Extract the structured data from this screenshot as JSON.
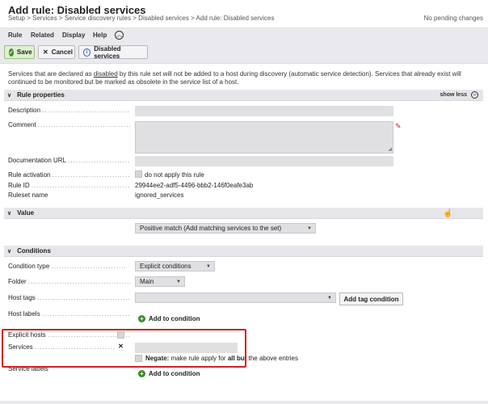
{
  "header": {
    "title": "Add rule: Disabled services",
    "breadcrumb": "Setup > Services > Service discovery rules > Disabled services > Add rule: Disabled services",
    "pending": "No pending changes"
  },
  "menu": {
    "items": [
      "Rule",
      "Related",
      "Display",
      "Help"
    ]
  },
  "toolbar": {
    "save_label": "Save",
    "cancel_label": "Cancel",
    "disabled_services_label": "Disabled services"
  },
  "help": {
    "part1": "Services that are declared as ",
    "link": "disabled",
    "part2": " by this rule set will not be added to a host during discovery (automatic service detection). Services that already exist will continued to be monitored but be marked as obsolete in the service list of a host."
  },
  "rule_properties": {
    "title": "Rule properties",
    "show_less": "show less",
    "description_label": "Description",
    "comment_label": "Comment",
    "documentation_label": "Documentation URL",
    "activation_label": "Rule activation",
    "activation_text": "do not apply this rule",
    "rule_id_label": "Rule ID",
    "rule_id_value": "29944ee2-adf5-4496-bbb2-146f0eafe3ab",
    "ruleset_label": "Ruleset name",
    "ruleset_value": "ignored_services"
  },
  "value": {
    "title": "Value",
    "selected": "Positive match (Add matching services to the set)"
  },
  "conditions": {
    "title": "Conditions",
    "condition_type_label": "Condition type",
    "condition_type_value": "Explicit conditions",
    "folder_label": "Folder",
    "folder_value": "Main",
    "host_tags_label": "Host tags",
    "add_tag_condition": "Add tag condition",
    "host_labels_label": "Host labels",
    "add_to_condition": "Add to condition",
    "explicit_hosts_label": "Explicit hosts",
    "services_label": "Services",
    "negate_bold1": "Negate:",
    "negate_text1": " make rule apply for ",
    "negate_bold2": "all but",
    "negate_text2": " the above entries",
    "service_labels_label": "Service labels",
    "add_to_condition_2": "Add to condition"
  },
  "colors": {
    "highlight": "#d62020",
    "save_green": "#3a8c2a"
  }
}
